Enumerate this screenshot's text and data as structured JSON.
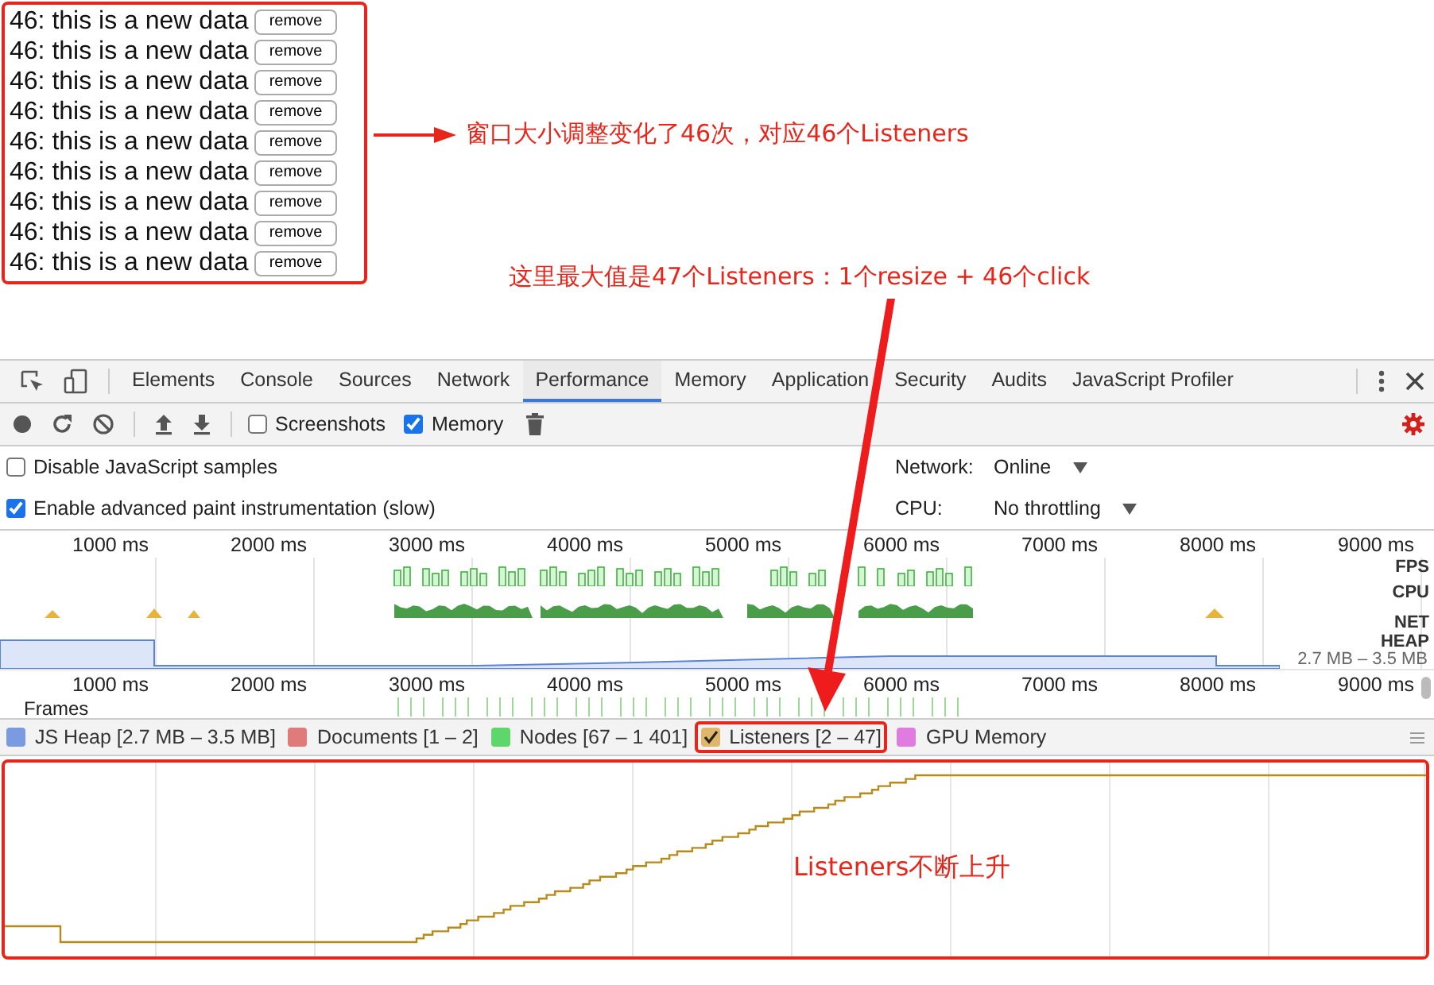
{
  "page": {
    "rows": [
      {
        "text": "46: this is a new data",
        "button": "remove"
      },
      {
        "text": "46: this is a new data",
        "button": "remove"
      },
      {
        "text": "46: this is a new data",
        "button": "remove"
      },
      {
        "text": "46: this is a new data",
        "button": "remove"
      },
      {
        "text": "46: this is a new data",
        "button": "remove"
      },
      {
        "text": "46: this is a new data",
        "button": "remove"
      },
      {
        "text": "46: this is a new data",
        "button": "remove"
      },
      {
        "text": "46: this is a new data",
        "button": "remove"
      },
      {
        "text": "46: this is a new data",
        "button": "remove"
      }
    ]
  },
  "annotations": [
    "窗口大小调整变化了46次，对应46个Listeners",
    "这里最大值是47个Listeners：1个resize +  46个click",
    "Listeners不断上升"
  ],
  "devtools": {
    "tabs": [
      {
        "label": "Elements",
        "selected": false
      },
      {
        "label": "Console",
        "selected": false
      },
      {
        "label": "Sources",
        "selected": false
      },
      {
        "label": "Network",
        "selected": false
      },
      {
        "label": "Performance",
        "selected": true
      },
      {
        "label": "Memory",
        "selected": false
      },
      {
        "label": "Application",
        "selected": false
      },
      {
        "label": "Security",
        "selected": false
      },
      {
        "label": "Audits",
        "selected": false
      },
      {
        "label": "JavaScript Profiler",
        "selected": false
      }
    ],
    "toolbar_options": [
      {
        "label": "Screenshots",
        "checked": false
      },
      {
        "label": "Memory",
        "checked": true
      }
    ],
    "settings": [
      {
        "label": "Disable JavaScript samples",
        "checked": false
      },
      {
        "label": "Enable advanced paint instrumentation (slow)",
        "checked": true
      }
    ],
    "throttling": [
      {
        "label": "Network:",
        "value": "Online"
      },
      {
        "label": "CPU:",
        "value": "No throttling"
      }
    ],
    "overview": {
      "ticks": [
        "1000 ms",
        "2000 ms",
        "3000 ms",
        "4000 ms",
        "5000 ms",
        "6000 ms",
        "7000 ms",
        "8000 ms",
        "9000 ms"
      ],
      "ticks_bottom": [
        "1000 ms",
        "2000 ms",
        "3000 ms",
        "4000 ms",
        "5000 ms",
        "6000 ms",
        "7000 ms",
        "8000 ms",
        "9000 ms"
      ],
      "tracks": [
        "FPS",
        "CPU",
        "NET",
        "HEAP"
      ],
      "heap_range": "2.7 MB – 3.5 MB",
      "frames_label": "Frames"
    },
    "counters": [
      {
        "label": "JS Heap [2.7 MB – 3.5 MB]",
        "color": "#7b9be0",
        "checked": false
      },
      {
        "label": "Documents [1 – 2]",
        "color": "#e07b7b",
        "checked": false
      },
      {
        "label": "Nodes [67 – 1 401]",
        "color": "#5fd66a",
        "checked": false
      },
      {
        "label": "Listeners [2 – 47]",
        "color": "#e0b66a",
        "checked": true
      },
      {
        "label": "GPU Memory",
        "color": "#e07be0",
        "checked": false
      }
    ]
  }
}
